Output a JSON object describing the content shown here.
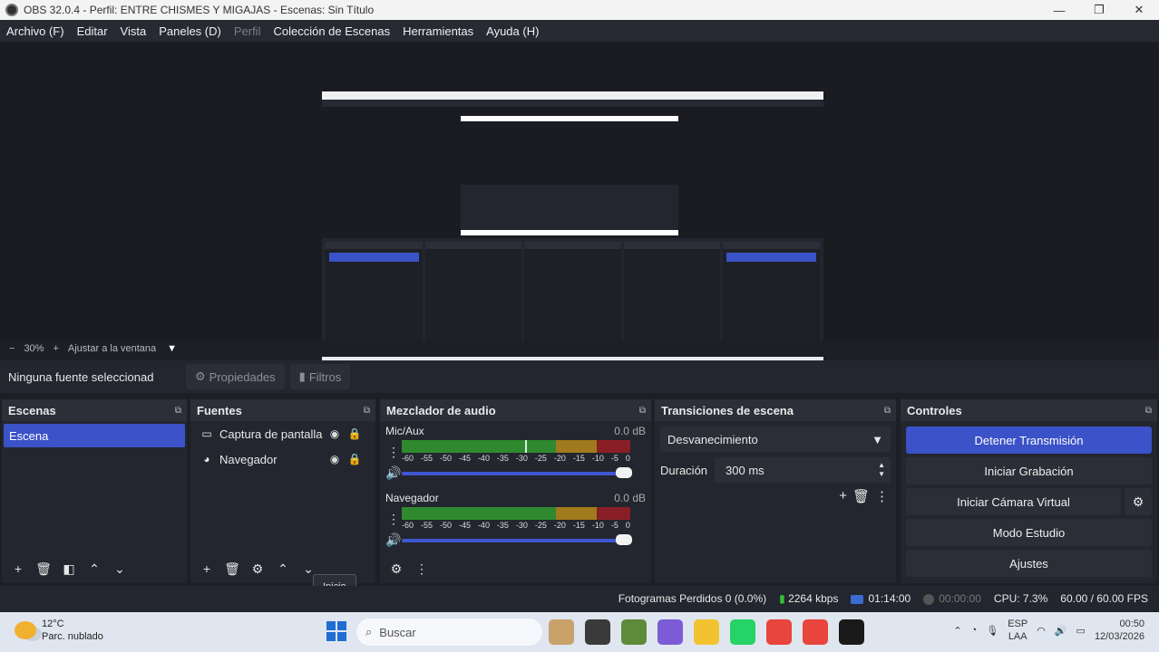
{
  "window": {
    "title": "OBS 32.0.4 - Perfil: ENTRE CHISMES Y MIGAJAS - Escenas: Sin Título",
    "controls": [
      "—",
      "❐",
      "✕"
    ]
  },
  "menu": [
    {
      "label": "Archivo (F)",
      "enabled": true
    },
    {
      "label": "Editar",
      "enabled": true
    },
    {
      "label": "Vista",
      "enabled": true
    },
    {
      "label": "Paneles (D)",
      "enabled": true
    },
    {
      "label": "Perfil",
      "enabled": false
    },
    {
      "label": "Colección de Escenas",
      "enabled": true
    },
    {
      "label": "Herramientas",
      "enabled": true
    },
    {
      "label": "Ayuda (H)",
      "enabled": true
    }
  ],
  "zoom": {
    "minus": "−",
    "value": "30%",
    "plus": "+",
    "fit_label": "Ajustar a la ventana",
    "dropdown": "▼"
  },
  "source_bar": {
    "no_source": "Ninguna fuente seleccionad",
    "properties": "Propiedades",
    "filters": "Filtros"
  },
  "scenes": {
    "title": "Escenas",
    "items": [
      "Escena"
    ],
    "selected": "Escena"
  },
  "sources": {
    "title": "Fuentes",
    "items": [
      {
        "label": "Captura de pantalla",
        "icon": "monitor-icon"
      },
      {
        "label": "Navegador",
        "icon": "globe-icon"
      }
    ]
  },
  "mixer": {
    "title": "Mezclador de audio",
    "ticks": [
      "-60",
      "-55",
      "-50",
      "-45",
      "-40",
      "-35",
      "-30",
      "-25",
      "-20",
      "-15",
      "-10",
      "-5",
      "0"
    ],
    "channels": [
      {
        "name": "Mic/Aux",
        "db": "0.0 dB",
        "volume": 1.0
      },
      {
        "name": "Navegador",
        "db": "0.0 dB",
        "volume": 1.0
      }
    ]
  },
  "transitions": {
    "title": "Transiciones de escena",
    "selected": "Desvanecimiento",
    "duration_label": "Duración",
    "duration_value": "300 ms"
  },
  "controls": {
    "title": "Controles",
    "stop_stream": "Detener Transmisión",
    "start_recording": "Iniciar Grabación",
    "start_virtual_cam": "Iniciar Cámara Virtual",
    "studio_mode": "Modo Estudio",
    "settings": "Ajustes"
  },
  "tooltip": "Inicio",
  "status": {
    "dropped_frames": "Fotogramas Perdidos 0 (0.0%)",
    "bitrate": "2264 kbps",
    "stream_time": "01:14:00",
    "rec_time": "00:00:00",
    "cpu": "CPU: 7.3%",
    "fps": "60.00 / 60.00 FPS"
  },
  "taskbar": {
    "temp": "12°C",
    "weather": "Parc. nublado",
    "search": "Buscar",
    "lang_top": "ESP",
    "lang_bottom": "LAA",
    "time": "00:50",
    "date": "12/03/2026",
    "app_colors": [
      "#c9a26b",
      "#3a3a3a",
      "#5f8a3a",
      "#7c5cd6",
      "#f2c230",
      "#25d366",
      "#e8453c",
      "#e8453c",
      "#1a1a1a"
    ]
  },
  "colors": {
    "accent": "#3b52c8",
    "meter_green": "#2f8a2f",
    "meter_yellow": "#a07a1c",
    "meter_red": "#8a1e26"
  }
}
